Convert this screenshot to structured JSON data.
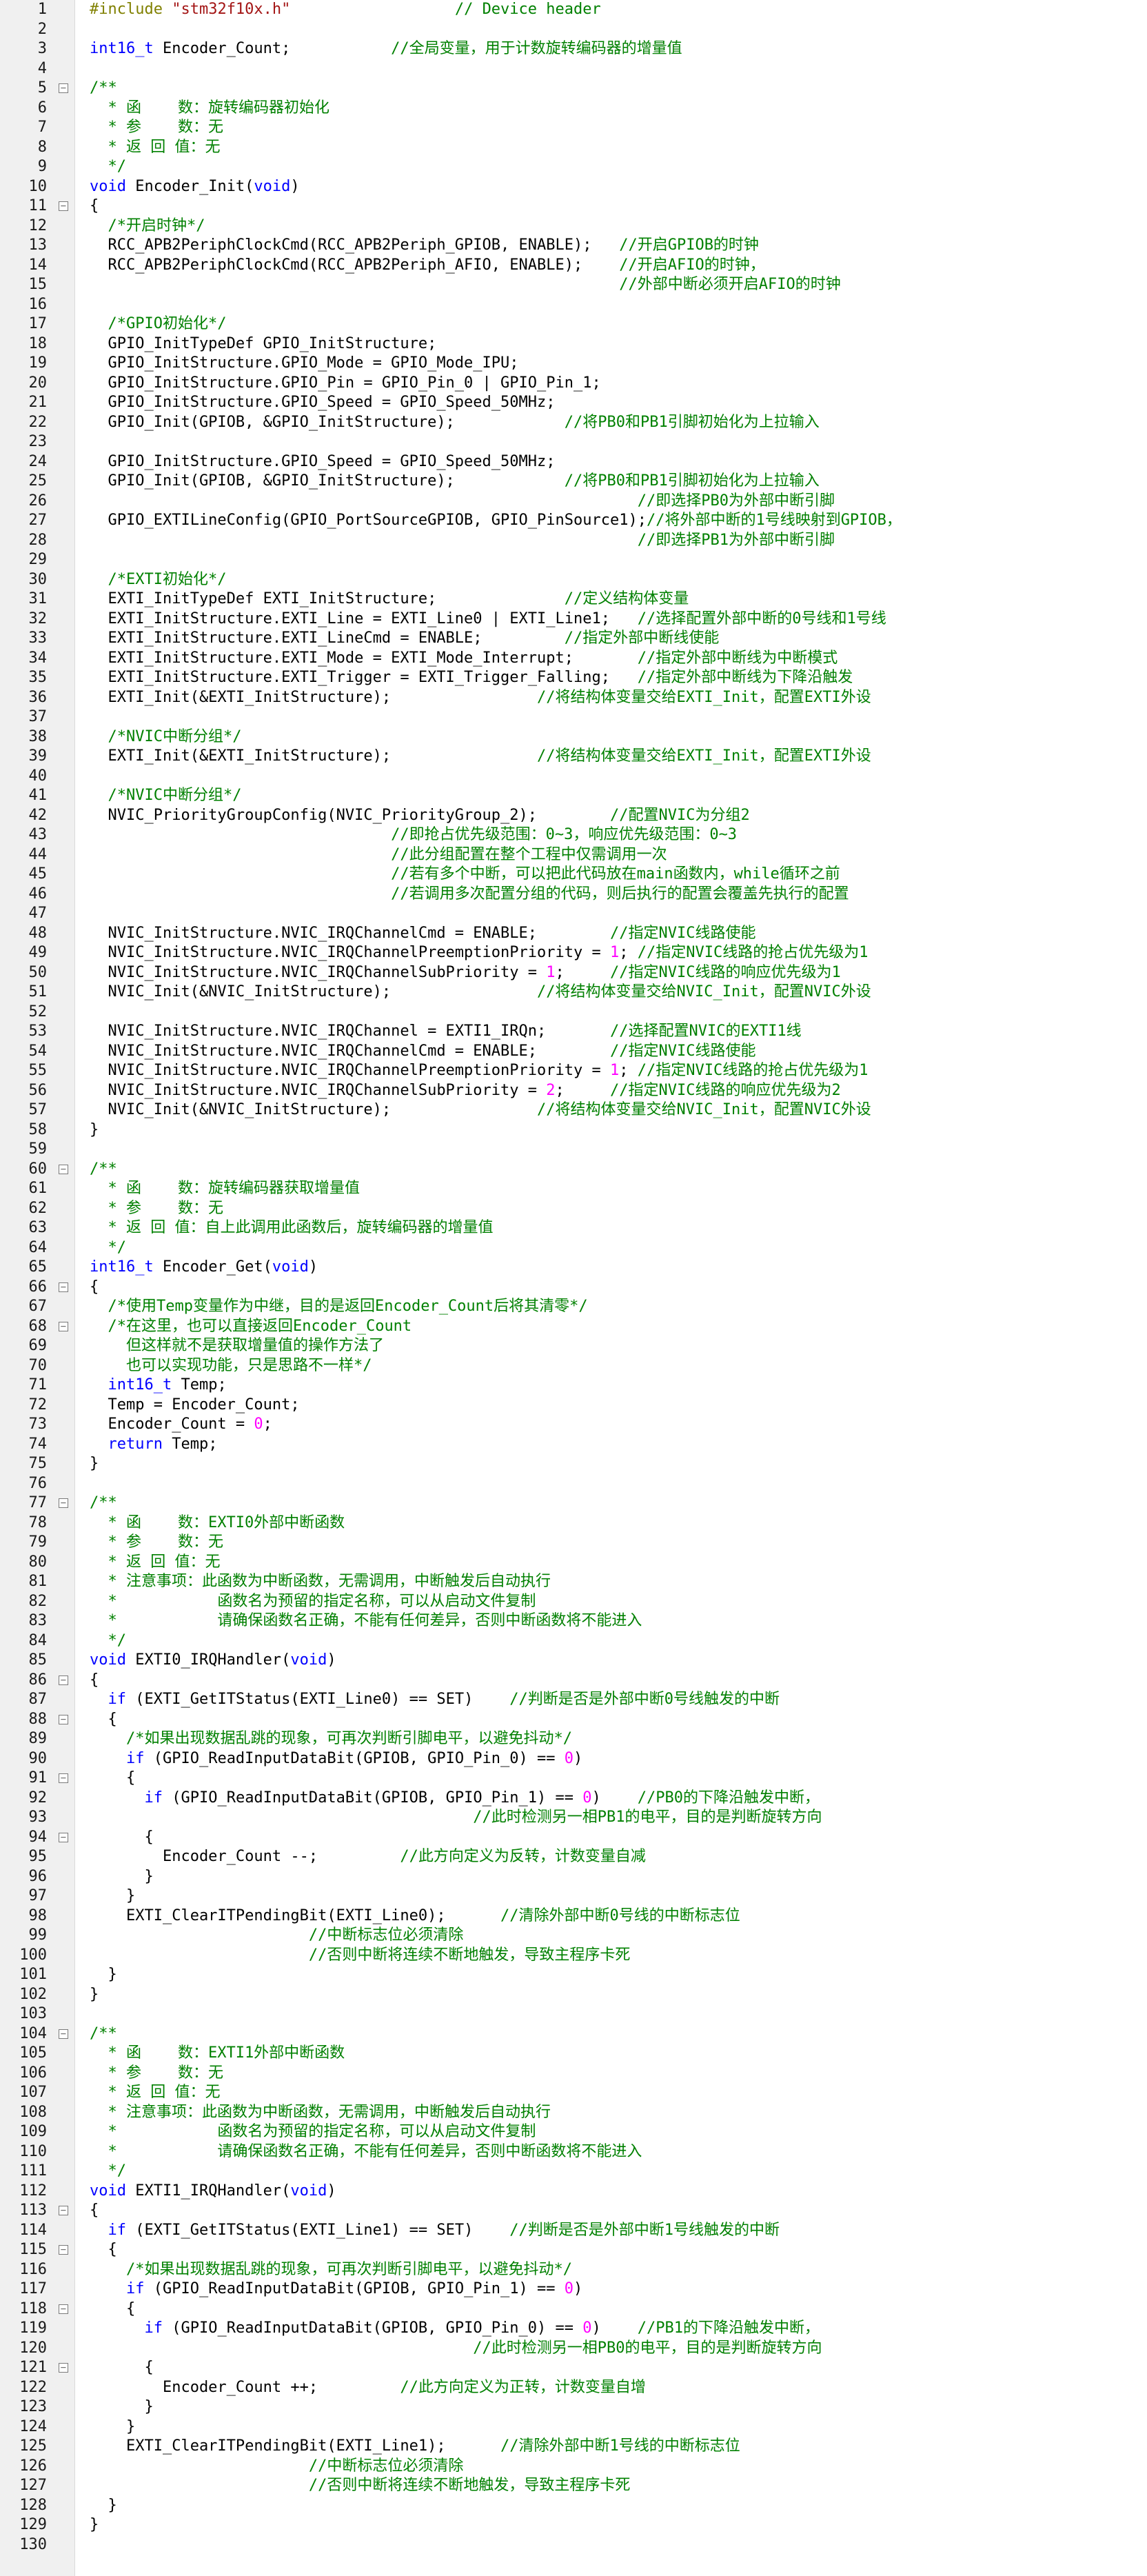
{
  "editor": {
    "lines": [
      {
        "n": "1",
        "fold": "",
        "text": "#include \"stm32f10x.h\"                  // Device header"
      },
      {
        "n": "2",
        "fold": "",
        "text": ""
      },
      {
        "n": "3",
        "fold": "",
        "text": "int16_t Encoder_Count;           //全局变量，用于计数旋转编码器的增量值"
      },
      {
        "n": "4",
        "fold": "",
        "text": ""
      },
      {
        "n": "5",
        "fold": "−",
        "text": "/**"
      },
      {
        "n": "6",
        "fold": "",
        "text": "  * 函    数：旋转编码器初始化"
      },
      {
        "n": "7",
        "fold": "",
        "text": "  * 参    数：无"
      },
      {
        "n": "8",
        "fold": "",
        "text": "  * 返 回 值：无"
      },
      {
        "n": "9",
        "fold": "",
        "text": "  */"
      },
      {
        "n": "10",
        "fold": "",
        "text": "void Encoder_Init(void)"
      },
      {
        "n": "11",
        "fold": "−",
        "text": "{"
      },
      {
        "n": "12",
        "fold": "",
        "text": "  /*开启时钟*/"
      },
      {
        "n": "13",
        "fold": "",
        "text": "  RCC_APB2PeriphClockCmd(RCC_APB2Periph_GPIOB, ENABLE);   //开启GPIOB的时钟"
      },
      {
        "n": "14",
        "fold": "",
        "text": "  RCC_APB2PeriphClockCmd(RCC_APB2Periph_AFIO, ENABLE);    //开启AFIO的时钟，"
      },
      {
        "n": "15",
        "fold": "",
        "text": "                                                          //外部中断必须开启AFIO的时钟"
      },
      {
        "n": "16",
        "fold": "",
        "text": ""
      },
      {
        "n": "17",
        "fold": "",
        "text": "  /*GPIO初始化*/"
      },
      {
        "n": "18",
        "fold": "",
        "text": "  GPIO_InitTypeDef GPIO_InitStructure;"
      },
      {
        "n": "19",
        "fold": "",
        "text": "  GPIO_InitStructure.GPIO_Mode = GPIO_Mode_IPU;"
      },
      {
        "n": "20",
        "fold": "",
        "text": "  GPIO_InitStructure.GPIO_Pin = GPIO_Pin_0 | GPIO_Pin_1;"
      },
      {
        "n": "21",
        "fold": "",
        "text": "  GPIO_InitStructure.GPIO_Speed = GPIO_Speed_50MHz;"
      },
      {
        "n": "22",
        "fold": "",
        "text": "  GPIO_Init(GPIOB, &GPIO_InitStructure);            //将PB0和PB1引脚初始化为上拉输入"
      },
      {
        "n": "23",
        "fold": "",
        "text": ""
      },
      {
        "n": "24",
        "fold": "",
        "text": "  GPIO_InitStructure.GPIO_Speed = GPIO_Speed_50MHz;"
      },
      {
        "n": "25",
        "fold": "",
        "text": "  GPIO_Init(GPIOB, &GPIO_InitStructure);            //将PB0和PB1引脚初始化为上拉输入"
      },
      {
        "n": "26",
        "fold": "",
        "text": "                                                            //即选择PB0为外部中断引脚"
      },
      {
        "n": "27",
        "fold": "",
        "text": "  GPIO_EXTILineConfig(GPIO_PortSourceGPIOB, GPIO_PinSource1);//将外部中断的1号线映射到GPIOB，"
      },
      {
        "n": "28",
        "fold": "",
        "text": "                                                            //即选择PB1为外部中断引脚"
      },
      {
        "n": "29",
        "fold": "",
        "text": ""
      },
      {
        "n": "30",
        "fold": "",
        "text": "  /*EXTI初始化*/"
      },
      {
        "n": "31",
        "fold": "",
        "text": "  EXTI_InitTypeDef EXTI_InitStructure;              //定义结构体变量"
      },
      {
        "n": "32",
        "fold": "",
        "text": "  EXTI_InitStructure.EXTI_Line = EXTI_Line0 | EXTI_Line1;   //选择配置外部中断的0号线和1号线"
      },
      {
        "n": "33",
        "fold": "",
        "text": "  EXTI_InitStructure.EXTI_LineCmd = ENABLE;         //指定外部中断线使能"
      },
      {
        "n": "34",
        "fold": "",
        "text": "  EXTI_InitStructure.EXTI_Mode = EXTI_Mode_Interrupt;       //指定外部中断线为中断模式"
      },
      {
        "n": "35",
        "fold": "",
        "text": "  EXTI_InitStructure.EXTI_Trigger = EXTI_Trigger_Falling;   //指定外部中断线为下降沿触发"
      },
      {
        "n": "36",
        "fold": "",
        "text": "  EXTI_Init(&EXTI_InitStructure);                //将结构体变量交给EXTI_Init，配置EXTI外设"
      },
      {
        "n": "37",
        "fold": "",
        "text": ""
      },
      {
        "n": "38",
        "fold": "",
        "text": "  /*NVIC中断分组*/"
      },
      {
        "n": "39",
        "fold": "",
        "text": "  EXTI_Init(&EXTI_InitStructure);                //将结构体变量交给EXTI_Init，配置EXTI外设"
      },
      {
        "n": "40",
        "fold": "",
        "text": ""
      },
      {
        "n": "41",
        "fold": "",
        "text": "  /*NVIC中断分组*/"
      },
      {
        "n": "42",
        "fold": "",
        "text": "  NVIC_PriorityGroupConfig(NVIC_PriorityGroup_2);        //配置NVIC为分组2"
      },
      {
        "n": "43",
        "fold": "",
        "text": "                                 //即抢占优先级范围：0~3，响应优先级范围：0~3"
      },
      {
        "n": "44",
        "fold": "",
        "text": "                                 //此分组配置在整个工程中仅需调用一次"
      },
      {
        "n": "45",
        "fold": "",
        "text": "                                 //若有多个中断，可以把此代码放在main函数内，while循环之前"
      },
      {
        "n": "46",
        "fold": "",
        "text": "                                 //若调用多次配置分组的代码，则后执行的配置会覆盖先执行的配置"
      },
      {
        "n": "47",
        "fold": "",
        "text": ""
      },
      {
        "n": "48",
        "fold": "",
        "text": "  NVIC_InitStructure.NVIC_IRQChannelCmd = ENABLE;        //指定NVIC线路使能"
      },
      {
        "n": "49",
        "fold": "",
        "text": "  NVIC_InitStructure.NVIC_IRQChannelPreemptionPriority = 1; //指定NVIC线路的抢占优先级为1"
      },
      {
        "n": "50",
        "fold": "",
        "text": "  NVIC_InitStructure.NVIC_IRQChannelSubPriority = 1;     //指定NVIC线路的响应优先级为1"
      },
      {
        "n": "51",
        "fold": "",
        "text": "  NVIC_Init(&NVIC_InitStructure);                //将结构体变量交给NVIC_Init，配置NVIC外设"
      },
      {
        "n": "52",
        "fold": "",
        "text": ""
      },
      {
        "n": "53",
        "fold": "",
        "text": "  NVIC_InitStructure.NVIC_IRQChannel = EXTI1_IRQn;       //选择配置NVIC的EXTI1线"
      },
      {
        "n": "54",
        "fold": "",
        "text": "  NVIC_InitStructure.NVIC_IRQChannelCmd = ENABLE;        //指定NVIC线路使能"
      },
      {
        "n": "55",
        "fold": "",
        "text": "  NVIC_InitStructure.NVIC_IRQChannelPreemptionPriority = 1; //指定NVIC线路的抢占优先级为1"
      },
      {
        "n": "56",
        "fold": "",
        "text": "  NVIC_InitStructure.NVIC_IRQChannelSubPriority = 2;     //指定NVIC线路的响应优先级为2"
      },
      {
        "n": "57",
        "fold": "",
        "text": "  NVIC_Init(&NVIC_InitStructure);                //将结构体变量交给NVIC_Init，配置NVIC外设"
      },
      {
        "n": "58",
        "fold": "",
        "text": "}"
      },
      {
        "n": "59",
        "fold": "",
        "text": ""
      },
      {
        "n": "60",
        "fold": "−",
        "text": "/**"
      },
      {
        "n": "61",
        "fold": "",
        "text": "  * 函    数：旋转编码器获取增量值"
      },
      {
        "n": "62",
        "fold": "",
        "text": "  * 参    数：无"
      },
      {
        "n": "63",
        "fold": "",
        "text": "  * 返 回 值：自上此调用此函数后，旋转编码器的增量值"
      },
      {
        "n": "64",
        "fold": "",
        "text": "  */"
      },
      {
        "n": "65",
        "fold": "",
        "text": "int16_t Encoder_Get(void)"
      },
      {
        "n": "66",
        "fold": "−",
        "text": "{"
      },
      {
        "n": "67",
        "fold": "",
        "text": "  /*使用Temp变量作为中继，目的是返回Encoder_Count后将其清零*/"
      },
      {
        "n": "68",
        "fold": "−",
        "text": "  /*在这里，也可以直接返回Encoder_Count"
      },
      {
        "n": "69",
        "fold": "",
        "text": "    但这样就不是获取增量值的操作方法了"
      },
      {
        "n": "70",
        "fold": "",
        "text": "    也可以实现功能，只是思路不一样*/"
      },
      {
        "n": "71",
        "fold": "",
        "text": "  int16_t Temp;"
      },
      {
        "n": "72",
        "fold": "",
        "text": "  Temp = Encoder_Count;"
      },
      {
        "n": "73",
        "fold": "",
        "text": "  Encoder_Count = 0;"
      },
      {
        "n": "74",
        "fold": "",
        "text": "  return Temp;"
      },
      {
        "n": "75",
        "fold": "",
        "text": "}"
      },
      {
        "n": "76",
        "fold": "",
        "text": ""
      },
      {
        "n": "77",
        "fold": "−",
        "text": "/**"
      },
      {
        "n": "78",
        "fold": "",
        "text": "  * 函    数：EXTI0外部中断函数"
      },
      {
        "n": "79",
        "fold": "",
        "text": "  * 参    数：无"
      },
      {
        "n": "80",
        "fold": "",
        "text": "  * 返 回 值：无"
      },
      {
        "n": "81",
        "fold": "",
        "text": "  * 注意事项：此函数为中断函数，无需调用，中断触发后自动执行"
      },
      {
        "n": "82",
        "fold": "",
        "text": "  *           函数名为预留的指定名称，可以从启动文件复制"
      },
      {
        "n": "83",
        "fold": "",
        "text": "  *           请确保函数名正确，不能有任何差异，否则中断函数将不能进入"
      },
      {
        "n": "84",
        "fold": "",
        "text": "  */"
      },
      {
        "n": "85",
        "fold": "",
        "text": "void EXTI0_IRQHandler(void)"
      },
      {
        "n": "86",
        "fold": "−",
        "text": "{"
      },
      {
        "n": "87",
        "fold": "",
        "text": "  if (EXTI_GetITStatus(EXTI_Line0) == SET)    //判断是否是外部中断0号线触发的中断"
      },
      {
        "n": "88",
        "fold": "−",
        "text": "  {"
      },
      {
        "n": "89",
        "fold": "",
        "text": "    /*如果出现数据乱跳的现象，可再次判断引脚电平，以避免抖动*/"
      },
      {
        "n": "90",
        "fold": "",
        "text": "    if (GPIO_ReadInputDataBit(GPIOB, GPIO_Pin_0) == 0)"
      },
      {
        "n": "91",
        "fold": "−",
        "text": "    {"
      },
      {
        "n": "92",
        "fold": "",
        "text": "      if (GPIO_ReadInputDataBit(GPIOB, GPIO_Pin_1) == 0)    //PB0的下降沿触发中断，"
      },
      {
        "n": "93",
        "fold": "",
        "text": "                                          //此时检测另一相PB1的电平，目的是判断旋转方向"
      },
      {
        "n": "94",
        "fold": "−",
        "text": "      {"
      },
      {
        "n": "95",
        "fold": "",
        "text": "        Encoder_Count --;         //此方向定义为反转，计数变量自减"
      },
      {
        "n": "96",
        "fold": "",
        "text": "      }"
      },
      {
        "n": "97",
        "fold": "",
        "text": "    }"
      },
      {
        "n": "98",
        "fold": "",
        "text": "    EXTI_ClearITPendingBit(EXTI_Line0);      //清除外部中断0号线的中断标志位"
      },
      {
        "n": "99",
        "fold": "",
        "text": "                        //中断标志位必须清除"
      },
      {
        "n": "100",
        "fold": "",
        "text": "                        //否则中断将连续不断地触发，导致主程序卡死"
      },
      {
        "n": "101",
        "fold": "",
        "text": "  }"
      },
      {
        "n": "102",
        "fold": "",
        "text": "}"
      },
      {
        "n": "103",
        "fold": "",
        "text": ""
      },
      {
        "n": "104",
        "fold": "−",
        "text": "/**"
      },
      {
        "n": "105",
        "fold": "",
        "text": "  * 函    数：EXTI1外部中断函数"
      },
      {
        "n": "106",
        "fold": "",
        "text": "  * 参    数：无"
      },
      {
        "n": "107",
        "fold": "",
        "text": "  * 返 回 值：无"
      },
      {
        "n": "108",
        "fold": "",
        "text": "  * 注意事项：此函数为中断函数，无需调用，中断触发后自动执行"
      },
      {
        "n": "109",
        "fold": "",
        "text": "  *           函数名为预留的指定名称，可以从启动文件复制"
      },
      {
        "n": "110",
        "fold": "",
        "text": "  *           请确保函数名正确，不能有任何差异，否则中断函数将不能进入"
      },
      {
        "n": "111",
        "fold": "",
        "text": "  */"
      },
      {
        "n": "112",
        "fold": "",
        "text": "void EXTI1_IRQHandler(void)"
      },
      {
        "n": "113",
        "fold": "−",
        "text": "{"
      },
      {
        "n": "114",
        "fold": "",
        "text": "  if (EXTI_GetITStatus(EXTI_Line1) == SET)    //判断是否是外部中断1号线触发的中断"
      },
      {
        "n": "115",
        "fold": "−",
        "text": "  {"
      },
      {
        "n": "116",
        "fold": "",
        "text": "    /*如果出现数据乱跳的现象，可再次判断引脚电平，以避免抖动*/"
      },
      {
        "n": "117",
        "fold": "",
        "text": "    if (GPIO_ReadInputDataBit(GPIOB, GPIO_Pin_1) == 0)"
      },
      {
        "n": "118",
        "fold": "−",
        "text": "    {"
      },
      {
        "n": "119",
        "fold": "",
        "text": "      if (GPIO_ReadInputDataBit(GPIOB, GPIO_Pin_0) == 0)    //PB1的下降沿触发中断，"
      },
      {
        "n": "120",
        "fold": "",
        "text": "                                          //此时检测另一相PB0的电平，目的是判断旋转方向"
      },
      {
        "n": "121",
        "fold": "−",
        "text": "      {"
      },
      {
        "n": "122",
        "fold": "",
        "text": "        Encoder_Count ++;         //此方向定义为正转，计数变量自增"
      },
      {
        "n": "123",
        "fold": "",
        "text": "      }"
      },
      {
        "n": "124",
        "fold": "",
        "text": "    }"
      },
      {
        "n": "125",
        "fold": "",
        "text": "    EXTI_ClearITPendingBit(EXTI_Line1);      //清除外部中断1号线的中断标志位"
      },
      {
        "n": "126",
        "fold": "",
        "text": "                        //中断标志位必须清除"
      },
      {
        "n": "127",
        "fold": "",
        "text": "                        //否则中断将连续不断地触发，导致主程序卡死"
      },
      {
        "n": "128",
        "fold": "",
        "text": "  }"
      },
      {
        "n": "129",
        "fold": "",
        "text": "}"
      },
      {
        "n": "130",
        "fold": "",
        "text": ""
      }
    ]
  },
  "colors": {
    "keyword": "#0000ff",
    "comment": "#008000",
    "number": "#ff00ff",
    "preprocessor": "#808000",
    "string": "#a31515",
    "plain": "#000000",
    "gutter_bg": "#f0f0f0"
  }
}
